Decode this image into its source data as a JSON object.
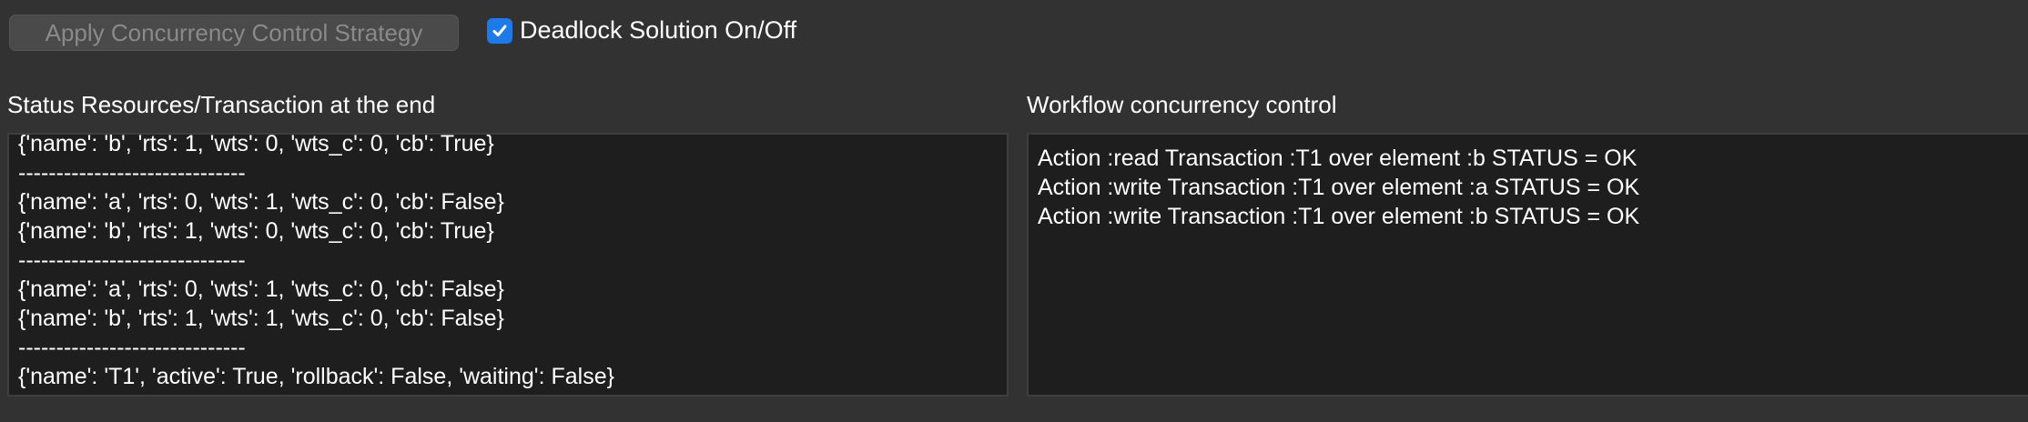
{
  "toolbar": {
    "apply_button_label": "Apply Concurrency Control Strategy",
    "deadlock_checkbox_label": "Deadlock Solution On/Off",
    "deadlock_checked": true
  },
  "left_panel": {
    "title": "Status Resources/Transaction at the end",
    "lines": [
      "{'name': 'b', 'rts': 1, 'wts': 0, 'wts_c': 0, 'cb': True}",
      "------------------------------",
      "{'name': 'a', 'rts': 0, 'wts': 1, 'wts_c': 0, 'cb': False}",
      "{'name': 'b', 'rts': 1, 'wts': 0, 'wts_c': 0, 'cb': True}",
      "------------------------------",
      "{'name': 'a', 'rts': 0, 'wts': 1, 'wts_c': 0, 'cb': False}",
      "{'name': 'b', 'rts': 1, 'wts': 1, 'wts_c': 0, 'cb': False}",
      "------------------------------",
      "{'name': 'T1', 'active': True, 'rollback': False, 'waiting': False}"
    ]
  },
  "right_panel": {
    "title": "Workflow concurrency control",
    "lines": [
      "Action :read Transaction :T1 over element :b STATUS = OK",
      "Action :write Transaction :T1 over element :a STATUS = OK",
      "Action :write Transaction :T1 over element :b STATUS = OK"
    ]
  }
}
